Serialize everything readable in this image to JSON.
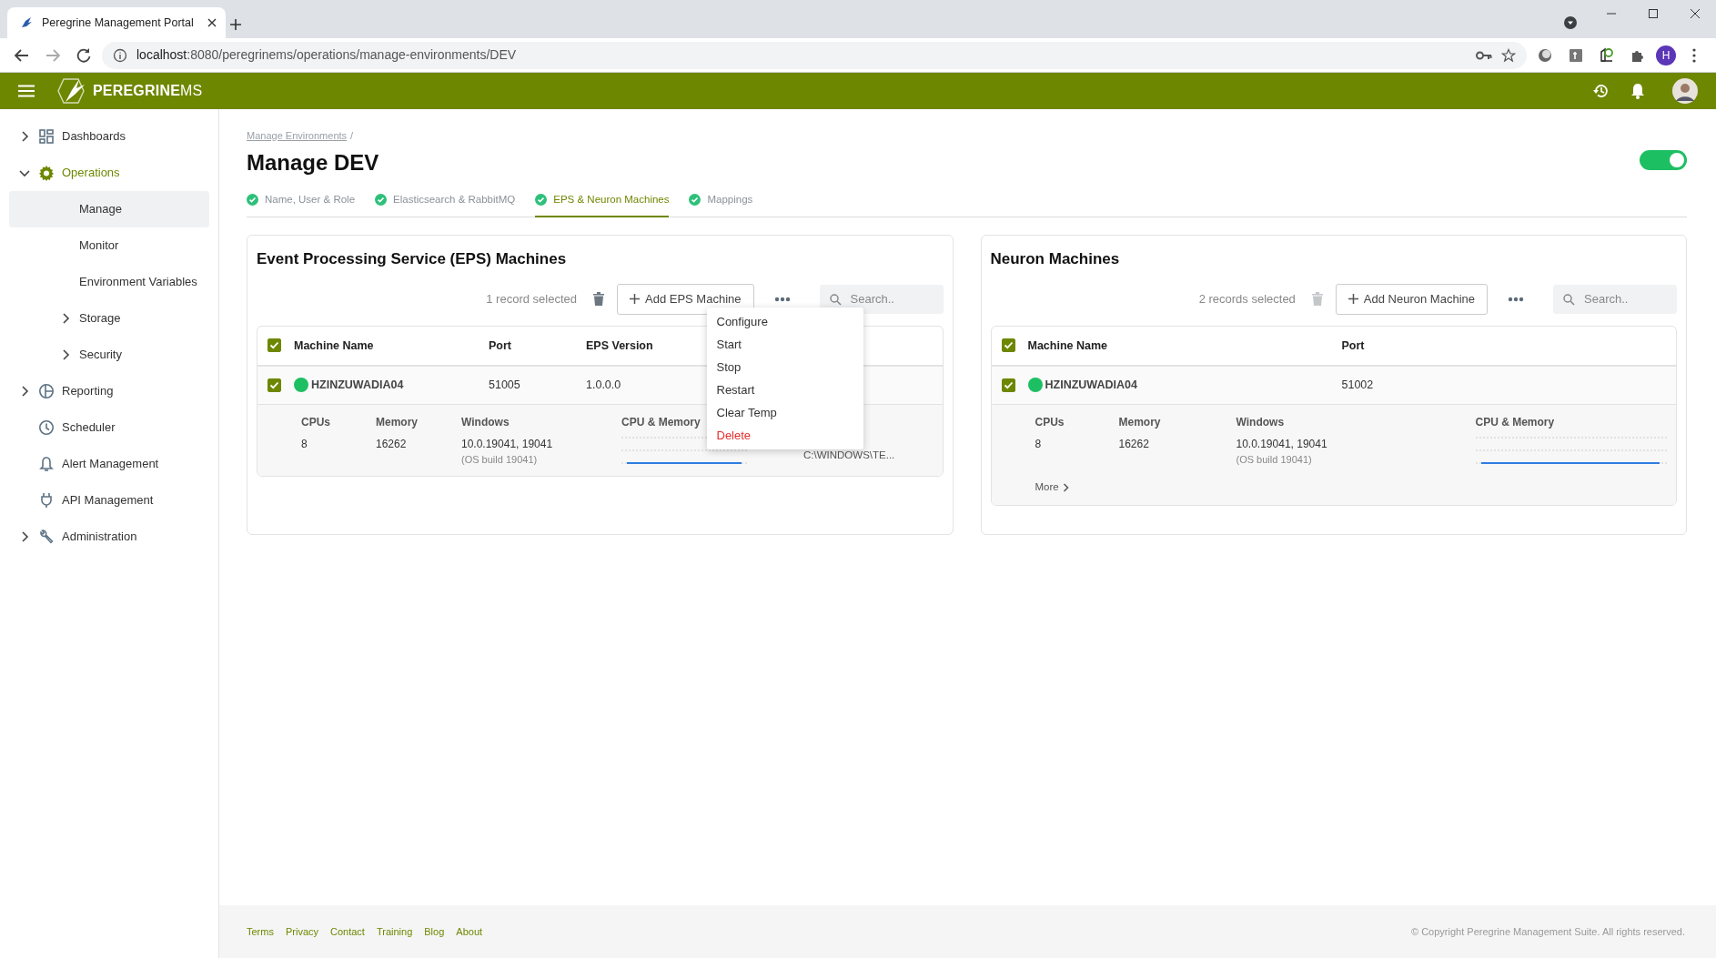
{
  "browser": {
    "tab_title": "Peregrine Management Portal",
    "url_host": "localhost",
    "url_rest": ":8080/peregrinems/operations/manage-environments/DEV",
    "profile_initial": "H"
  },
  "header": {
    "brand_main": "PEREGRINE",
    "brand_suffix": "MS"
  },
  "sidebar": {
    "items": [
      {
        "label": "Dashboards",
        "kind": "group",
        "expanded": false,
        "selected": false
      },
      {
        "label": "Operations",
        "kind": "group",
        "expanded": true,
        "selected": false,
        "children": [
          {
            "label": "Manage",
            "kind": "link",
            "selected": true
          },
          {
            "label": "Monitor",
            "kind": "link",
            "selected": false
          },
          {
            "label": "Environment Variables",
            "kind": "link",
            "selected": false
          },
          {
            "label": "Storage",
            "kind": "group",
            "expanded": false,
            "selected": false
          },
          {
            "label": "Security",
            "kind": "group",
            "expanded": false,
            "selected": false
          }
        ]
      },
      {
        "label": "Reporting",
        "kind": "group",
        "expanded": false,
        "selected": false
      },
      {
        "label": "Scheduler",
        "kind": "link",
        "selected": false
      },
      {
        "label": "Alert Management",
        "kind": "link",
        "selected": false
      },
      {
        "label": "API Management",
        "kind": "link",
        "selected": false
      },
      {
        "label": "Administration",
        "kind": "group",
        "expanded": false,
        "selected": false
      }
    ]
  },
  "breadcrumb": [
    {
      "label": "Manage Environments",
      "separator": "/"
    }
  ],
  "page_title": "Manage DEV",
  "environment_toggle": {
    "on": true
  },
  "tabs": [
    {
      "label": "Name, User & Role",
      "selected": false,
      "complete": true
    },
    {
      "label": "Elasticsearch & RabbitMQ",
      "selected": false,
      "complete": true
    },
    {
      "label": "EPS & Neuron Machines",
      "selected": true,
      "complete": true
    },
    {
      "label": "Mappings",
      "selected": false,
      "complete": true
    }
  ],
  "panels": [
    {
      "title": "Event Processing Service (EPS) Machines",
      "selection_text": "1 record selected",
      "delete_disabled": false,
      "add_button": "Add EPS Machine",
      "search_placeholder": "Search..",
      "all_checked": true,
      "columns": [
        "Machine Name",
        "Port",
        "EPS Version"
      ],
      "rows": [
        {
          "checked": true,
          "color": "#1dbf63",
          "cells": [
            "HZINZUWADIA04",
            "51005",
            "1.0.0.0"
          ],
          "details": [
            {
              "label": "CPUs",
              "value": "8"
            },
            {
              "label": "Memory",
              "value": "16262"
            },
            {
              "label": "Windows",
              "value": "10.0.19041, 19041",
              "note": "(OS build 19041)"
            }
          ],
          "chart_label": "CPU & Memory",
          "extra": "C:\\WINDOWS\\TE..."
        }
      ],
      "menu": [
        {
          "label": "Configure",
          "kind": "normal"
        },
        {
          "label": "Start",
          "kind": "normal"
        },
        {
          "label": "Stop",
          "kind": "normal"
        },
        {
          "label": "Restart",
          "kind": "normal"
        },
        {
          "label": "Clear Temp",
          "kind": "normal"
        },
        {
          "label": "Delete",
          "kind": "danger"
        }
      ]
    },
    {
      "title": "Neuron Machines",
      "selection_text": "2 records selected",
      "delete_disabled": true,
      "add_button": "Add Neuron Machine",
      "search_placeholder": "Search..",
      "all_checked": true,
      "columns": [
        "Machine Name",
        "Port"
      ],
      "rows": [
        {
          "checked": true,
          "color": "#1dbf63",
          "cells": [
            "HZINZUWADIA04",
            "51002"
          ],
          "details": [
            {
              "label": "CPUs",
              "value": "8"
            },
            {
              "label": "Memory",
              "value": "16262"
            },
            {
              "label": "Windows",
              "value": "10.0.19041, 19041",
              "note": "(OS build 19041)"
            }
          ],
          "chart_label": "CPU & Memory",
          "more_link": "More"
        }
      ]
    }
  ],
  "footer": {
    "links": [
      "Terms",
      "Privacy",
      "Contact",
      "Training",
      "Blog",
      "About"
    ],
    "copyright": "© Copyright Peregrine Management Suite. All rights reserved."
  }
}
